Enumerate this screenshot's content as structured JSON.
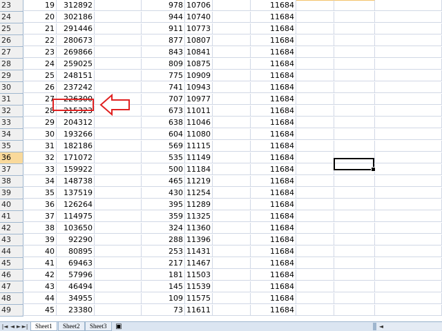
{
  "rows": [
    {
      "num": "23",
      "a": "19",
      "b": "312892",
      "c": "978",
      "d": "10706",
      "e": "11684"
    },
    {
      "num": "24",
      "a": "20",
      "b": "302186",
      "c": "944",
      "d": "10740",
      "e": "11684"
    },
    {
      "num": "25",
      "a": "21",
      "b": "291446",
      "c": "911",
      "d": "10773",
      "e": "11684"
    },
    {
      "num": "26",
      "a": "22",
      "b": "280673",
      "c": "877",
      "d": "10807",
      "e": "11684"
    },
    {
      "num": "27",
      "a": "23",
      "b": "269866",
      "c": "843",
      "d": "10841",
      "e": "11684"
    },
    {
      "num": "28",
      "a": "24",
      "b": "259025",
      "c": "809",
      "d": "10875",
      "e": "11684"
    },
    {
      "num": "29",
      "a": "25",
      "b": "248151",
      "c": "775",
      "d": "10909",
      "e": "11684"
    },
    {
      "num": "30",
      "a": "26",
      "b": "237242",
      "c": "741",
      "d": "10943",
      "e": "11684"
    },
    {
      "num": "31",
      "a": "27",
      "b": "226300",
      "c": "707",
      "d": "10977",
      "e": "11684"
    },
    {
      "num": "32",
      "a": "28",
      "b": "215323",
      "c": "673",
      "d": "11011",
      "e": "11684"
    },
    {
      "num": "33",
      "a": "29",
      "b": "204312",
      "c": "638",
      "d": "11046",
      "e": "11684"
    },
    {
      "num": "34",
      "a": "30",
      "b": "193266",
      "c": "604",
      "d": "11080",
      "e": "11684"
    },
    {
      "num": "35",
      "a": "31",
      "b": "182186",
      "c": "569",
      "d": "11115",
      "e": "11684"
    },
    {
      "num": "36",
      "a": "32",
      "b": "171072",
      "c": "535",
      "d": "11149",
      "e": "11684"
    },
    {
      "num": "37",
      "a": "33",
      "b": "159922",
      "c": "500",
      "d": "11184",
      "e": "11684"
    },
    {
      "num": "38",
      "a": "34",
      "b": "148738",
      "c": "465",
      "d": "11219",
      "e": "11684"
    },
    {
      "num": "39",
      "a": "35",
      "b": "137519",
      "c": "430",
      "d": "11254",
      "e": "11684"
    },
    {
      "num": "40",
      "a": "36",
      "b": "126264",
      "c": "395",
      "d": "11289",
      "e": "11684"
    },
    {
      "num": "41",
      "a": "37",
      "b": "114975",
      "c": "359",
      "d": "11325",
      "e": "11684"
    },
    {
      "num": "42",
      "a": "38",
      "b": "103650",
      "c": "324",
      "d": "11360",
      "e": "11684"
    },
    {
      "num": "43",
      "a": "39",
      "b": "92290",
      "c": "288",
      "d": "11396",
      "e": "11684"
    },
    {
      "num": "44",
      "a": "40",
      "b": "80895",
      "c": "253",
      "d": "11431",
      "e": "11684"
    },
    {
      "num": "45",
      "a": "41",
      "b": "69463",
      "c": "217",
      "d": "11467",
      "e": "11684"
    },
    {
      "num": "46",
      "a": "42",
      "b": "57996",
      "c": "181",
      "d": "11503",
      "e": "11684"
    },
    {
      "num": "47",
      "a": "43",
      "b": "46494",
      "c": "145",
      "d": "11539",
      "e": "11684"
    },
    {
      "num": "48",
      "a": "44",
      "b": "34955",
      "c": "109",
      "d": "11575",
      "e": "11684"
    },
    {
      "num": "49",
      "a": "45",
      "b": "23380",
      "c": "73",
      "d": "11611",
      "e": "11684"
    }
  ],
  "active_row": "36",
  "sheet_tabs": [
    "Sheet1",
    "Sheet2",
    "Sheet3"
  ],
  "active_sheet": "Sheet1",
  "nav_icons": [
    "first-sheet-icon",
    "prev-sheet-icon",
    "next-sheet-icon",
    "last-sheet-icon"
  ],
  "colors": {
    "highlight": "#e02020",
    "active_row_header": "#f9d99b",
    "gridline": "#d0d7e5"
  }
}
